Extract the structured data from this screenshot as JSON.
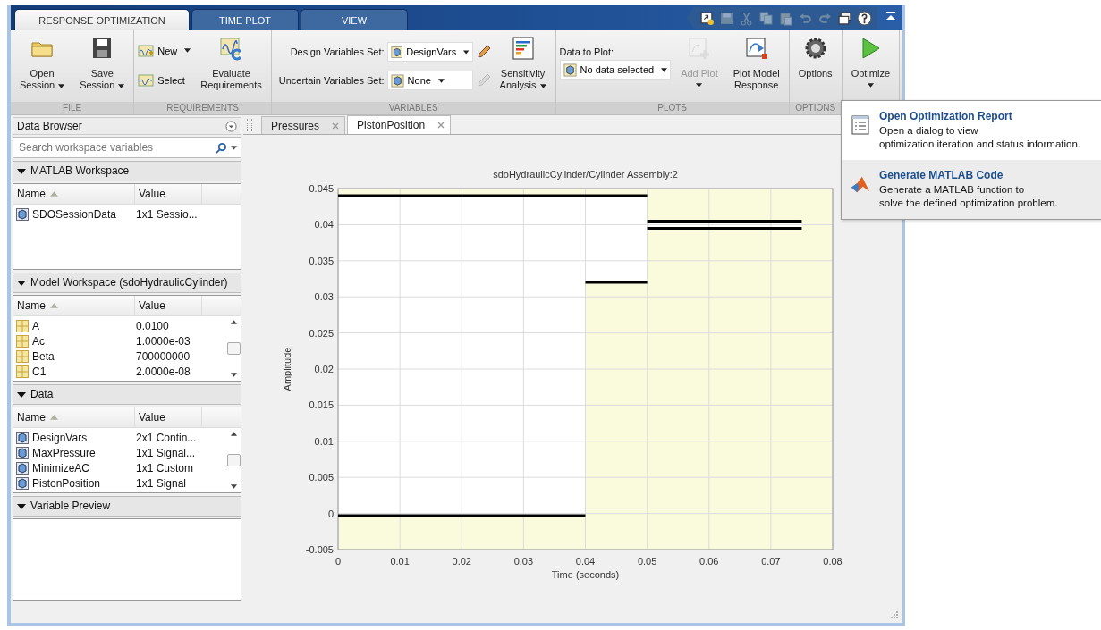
{
  "window_tabs": [
    {
      "label": "RESPONSE OPTIMIZATION",
      "selected": true
    },
    {
      "label": "TIME PLOT",
      "selected": false
    },
    {
      "label": "VIEW",
      "selected": false
    }
  ],
  "toolstrip": [
    {
      "label": "FILE",
      "buttons": [
        {
          "lines": [
            "Open",
            "Session"
          ],
          "dropdown": true,
          "disabled": false
        },
        {
          "lines": [
            "Save",
            "Session"
          ],
          "dropdown": true,
          "disabled": false
        }
      ]
    },
    {
      "label": "REQUIREMENTS",
      "small_buttons": [
        {
          "label": "New",
          "dropdown": true
        },
        {
          "label": "Select",
          "dropdown": false
        }
      ],
      "buttons": [
        {
          "lines": [
            "Evaluate",
            "Requirements"
          ],
          "dropdown": false,
          "disabled": false
        }
      ]
    },
    {
      "label": "VARIABLES",
      "sets": [
        {
          "label": "Design Variables Set:",
          "value": "DesignVars",
          "edit_disabled": false
        },
        {
          "label": "Uncertain Variables Set:",
          "value": "None",
          "edit_disabled": true
        }
      ],
      "buttons": [
        {
          "lines": [
            "Sensitivity",
            "Analysis"
          ],
          "dropdown": true,
          "disabled": false
        }
      ]
    },
    {
      "label": "PLOTS",
      "data_to_plot": {
        "label": "Data to Plot:",
        "value": "No data selected"
      },
      "buttons": [
        {
          "lines": [
            "Add Plot"
          ],
          "dropdown": true,
          "disabled": true
        },
        {
          "lines": [
            "Plot Model",
            "Response"
          ],
          "dropdown": false,
          "disabled": false
        }
      ]
    },
    {
      "label": "OPTIONS",
      "buttons": [
        {
          "lines": [
            "Options"
          ],
          "dropdown": false,
          "disabled": false
        }
      ]
    },
    {
      "buttons": [
        {
          "lines": [
            "Optimize"
          ],
          "dropdown": true,
          "disabled": false
        }
      ]
    }
  ],
  "data_browser": {
    "title": "Data Browser",
    "search": {
      "placeholder": "Search workspace variables"
    },
    "sections": [
      {
        "title": "MATLAB Workspace",
        "columns": [
          "Name",
          "Value"
        ],
        "rows": [
          {
            "kind": "object",
            "name": "SDOSessionData",
            "value": "1x1 Sessio..."
          }
        ]
      },
      {
        "title": "Model Workspace (sdoHydraulicCylinder)",
        "columns": [
          "Name",
          "Value"
        ],
        "rows": [
          {
            "kind": "matrix",
            "name": "A",
            "value": "0.0100"
          },
          {
            "kind": "matrix",
            "name": "Ac",
            "value": "1.0000e-03"
          },
          {
            "kind": "matrix",
            "name": "Beta",
            "value": "700000000"
          },
          {
            "kind": "matrix",
            "name": "C1",
            "value": "2.0000e-08"
          }
        ]
      },
      {
        "title": "Data",
        "columns": [
          "Name",
          "Value"
        ],
        "rows": [
          {
            "kind": "object",
            "name": "DesignVars",
            "value": "2x1 Contin..."
          },
          {
            "kind": "object",
            "name": "MaxPressure",
            "value": "1x1 Signal..."
          },
          {
            "kind": "object",
            "name": "MinimizeAC",
            "value": "1x1 Custom"
          },
          {
            "kind": "object",
            "name": "PistonPosition",
            "value": "1x1 Signal"
          }
        ]
      },
      {
        "title": "Variable Preview"
      }
    ]
  },
  "document_tabs": [
    {
      "label": "Pressures",
      "selected": false
    },
    {
      "label": "PistonPosition",
      "selected": true
    }
  ],
  "plot": {
    "chart_data": {
      "type": "line",
      "title": "sdoHydraulicCylinder/Cylinder Assembly:2",
      "xlabel": "Time (seconds)",
      "ylabel": "Amplitude",
      "x": [
        0,
        0.04,
        0.05,
        0.075
      ],
      "series": [
        {
          "color": "#000000",
          "values": [
            0.044,
            0.044,
            0.044,
            null
          ]
        },
        {
          "color": "#000000",
          "values": [
            null,
            null,
            0.0405,
            0.0405
          ]
        },
        {
          "color": "#000000",
          "values": [
            -0.0003,
            -0.0003,
            null,
            null
          ]
        },
        {
          "color": "#000000",
          "values": [
            null,
            0.032,
            0.032,
            null
          ]
        },
        {
          "color": "#000000",
          "values": [
            null,
            null,
            0.0395,
            0.0395
          ]
        }
      ],
      "xlim": [
        0,
        0.08
      ],
      "ylim": [
        -0.005,
        0.045
      ],
      "grid": true,
      "xticks": [
        0,
        0.01,
        0.02,
        0.03,
        0.04,
        0.05,
        0.06,
        0.07,
        0.08
      ],
      "yticks": [
        -0.005,
        0,
        0.005,
        0.01,
        0.015,
        0.02,
        0.025,
        0.03,
        0.035,
        0.04,
        0.045
      ]
    }
  },
  "optimize_menu": {
    "items": [
      {
        "title": "Open Optimization Report",
        "description": [
          "Open a dialog to view",
          "optimization iteration and status information."
        ],
        "selected": false
      },
      {
        "title": "Generate MATLAB Code",
        "description": [
          "Generate a MATLAB function to",
          "solve the defined optimization problem."
        ],
        "selected": true
      }
    ]
  }
}
